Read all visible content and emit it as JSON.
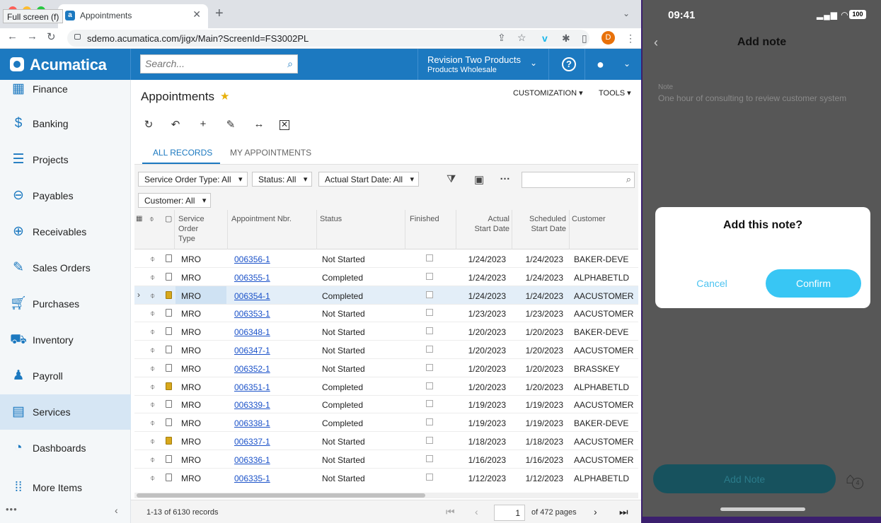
{
  "browser": {
    "tooltip": "Full screen (f)",
    "tab_title": "Appointments",
    "url": "sdemo.acumatica.com/jigx/Main?ScreenId=FS3002PL",
    "profile_initial": "D"
  },
  "header": {
    "logo": "Acumatica",
    "search_placeholder": "Search...",
    "company_name": "Revision Two Products",
    "company_branch": "Products Wholesale"
  },
  "sidebar": {
    "items": [
      {
        "label": "Finance",
        "icon": "calculator-icon"
      },
      {
        "label": "Banking",
        "icon": "dollar-icon"
      },
      {
        "label": "Projects",
        "icon": "projects-icon"
      },
      {
        "label": "Payables",
        "icon": "minus-circle-icon"
      },
      {
        "label": "Receivables",
        "icon": "plus-circle-icon"
      },
      {
        "label": "Sales Orders",
        "icon": "pencil-edit-icon"
      },
      {
        "label": "Purchases",
        "icon": "cart-icon"
      },
      {
        "label": "Inventory",
        "icon": "truck-icon"
      },
      {
        "label": "Payroll",
        "icon": "people-dollar-icon"
      },
      {
        "label": "Services",
        "icon": "briefcase-icon"
      },
      {
        "label": "Dashboards",
        "icon": "gauge-icon"
      },
      {
        "label": "More Items",
        "icon": "grid-dots-icon"
      }
    ],
    "active": "Services"
  },
  "main": {
    "title": "Appointments",
    "menus": [
      "CUSTOMIZATION",
      "TOOLS"
    ],
    "tabs": [
      "ALL RECORDS",
      "MY APPOINTMENTS"
    ],
    "filters": {
      "service_order_type": "Service Order Type: All",
      "status": "Status: All",
      "actual_start_date": "Actual Start Date: All",
      "customer": "Customer: All"
    },
    "columns": {
      "service_order_type": "Service\nOrder\nType",
      "appointment_nbr": "Appointment Nbr.",
      "status": "Status",
      "finished": "Finished",
      "actual_start_date": "Actual\nStart Date",
      "scheduled_start_date": "Scheduled\nStart Date",
      "customer": "Customer"
    },
    "rows": [
      {
        "type": "MRO",
        "nbr": "006356-1",
        "status": "Not Started",
        "actual": "1/24/2023",
        "scheduled": "1/24/2023",
        "customer": "BAKER-DEVE",
        "note": false
      },
      {
        "type": "MRO",
        "nbr": "006355-1",
        "status": "Completed",
        "actual": "1/24/2023",
        "scheduled": "1/24/2023",
        "customer": "ALPHABETLD",
        "note": false
      },
      {
        "type": "MRO",
        "nbr": "006354-1",
        "status": "Completed",
        "actual": "1/24/2023",
        "scheduled": "1/24/2023",
        "customer": "AACUSTOMER",
        "note": true
      },
      {
        "type": "MRO",
        "nbr": "006353-1",
        "status": "Not Started",
        "actual": "1/23/2023",
        "scheduled": "1/23/2023",
        "customer": "AACUSTOMER",
        "note": false
      },
      {
        "type": "MRO",
        "nbr": "006348-1",
        "status": "Not Started",
        "actual": "1/20/2023",
        "scheduled": "1/20/2023",
        "customer": "BAKER-DEVE",
        "note": false
      },
      {
        "type": "MRO",
        "nbr": "006347-1",
        "status": "Not Started",
        "actual": "1/20/2023",
        "scheduled": "1/20/2023",
        "customer": "AACUSTOMER",
        "note": false
      },
      {
        "type": "MRO",
        "nbr": "006352-1",
        "status": "Not Started",
        "actual": "1/20/2023",
        "scheduled": "1/20/2023",
        "customer": "BRASSKEY",
        "note": false
      },
      {
        "type": "MRO",
        "nbr": "006351-1",
        "status": "Completed",
        "actual": "1/20/2023",
        "scheduled": "1/20/2023",
        "customer": "ALPHABETLD",
        "note": true
      },
      {
        "type": "MRO",
        "nbr": "006339-1",
        "status": "Completed",
        "actual": "1/19/2023",
        "scheduled": "1/19/2023",
        "customer": "AACUSTOMER",
        "note": false
      },
      {
        "type": "MRO",
        "nbr": "006338-1",
        "status": "Completed",
        "actual": "1/19/2023",
        "scheduled": "1/19/2023",
        "customer": "BAKER-DEVE",
        "note": false
      },
      {
        "type": "MRO",
        "nbr": "006337-1",
        "status": "Not Started",
        "actual": "1/18/2023",
        "scheduled": "1/18/2023",
        "customer": "AACUSTOMER",
        "note": true
      },
      {
        "type": "MRO",
        "nbr": "006336-1",
        "status": "Not Started",
        "actual": "1/16/2023",
        "scheduled": "1/16/2023",
        "customer": "AACUSTOMER",
        "note": false
      },
      {
        "type": "MRO",
        "nbr": "006335-1",
        "status": "Not Started",
        "actual": "1/12/2023",
        "scheduled": "1/12/2023",
        "customer": "ALPHABETLD",
        "note": false
      }
    ],
    "pager": {
      "records": "1-13 of 6130 records",
      "page": "1",
      "of_pages": "of 472 pages"
    }
  },
  "phone": {
    "time": "09:41",
    "battery": "100",
    "title": "Add note",
    "note_label": "Note",
    "note_text": "One hour of consulting to review customer system",
    "dialog_title": "Add this note?",
    "cancel": "Cancel",
    "confirm": "Confirm",
    "add_note": "Add Note",
    "home_badge": "4"
  },
  "colors": {
    "acumatica_blue": "#1c79c0",
    "confirm_cyan": "#38c6f4",
    "link": "#1b52c9"
  }
}
